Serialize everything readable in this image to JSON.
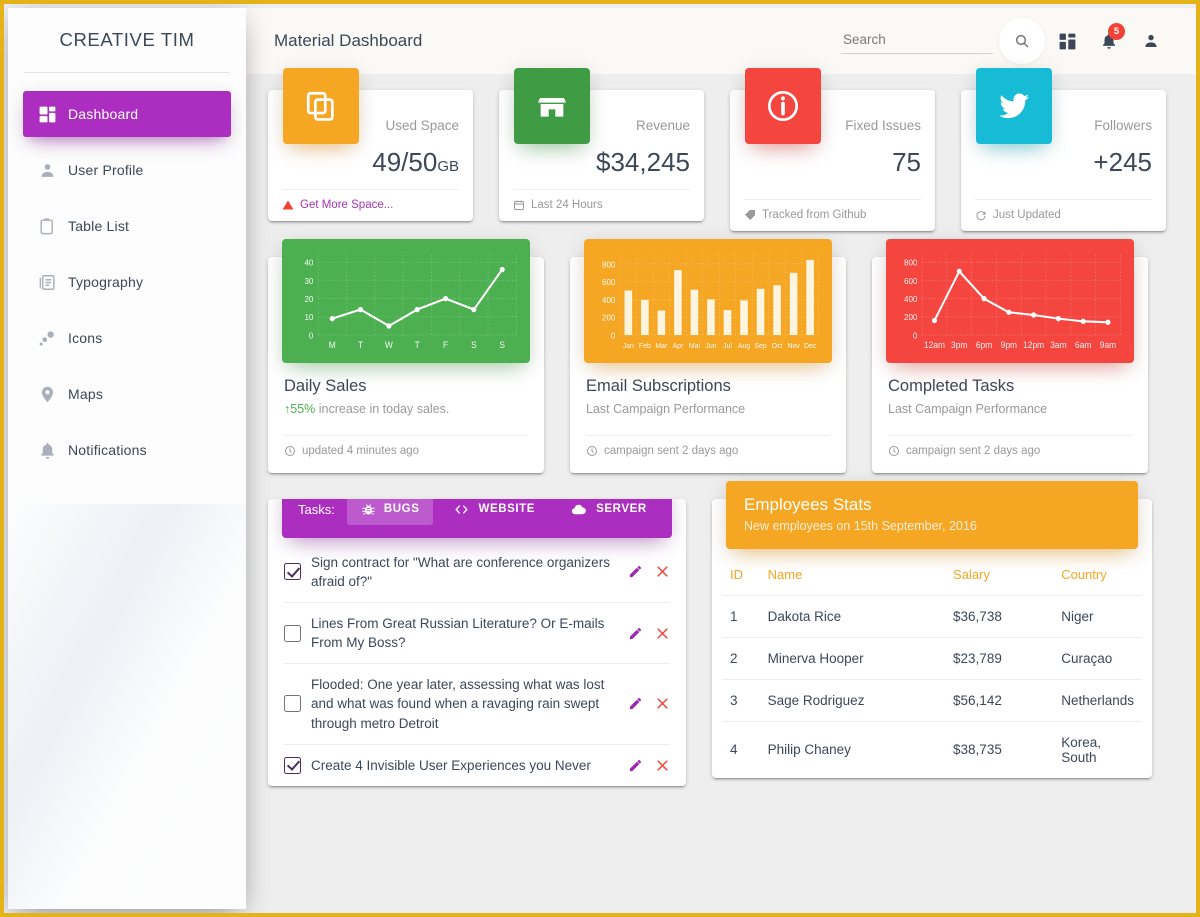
{
  "theme": {
    "purple": "#ab2ec0",
    "orange": "#f5a623",
    "green": "#4caf50",
    "red": "#f4453f",
    "blue": "#00bcd4",
    "page_border": "#e4b319"
  },
  "sidebar": {
    "brand": "CREATIVE TIM",
    "items": [
      {
        "label": "Dashboard",
        "icon": "dashboard-icon",
        "active": true
      },
      {
        "label": "User Profile",
        "icon": "person-icon",
        "active": false
      },
      {
        "label": "Table List",
        "icon": "clipboard-icon",
        "active": false
      },
      {
        "label": "Typography",
        "icon": "typography-icon",
        "active": false
      },
      {
        "label": "Icons",
        "icon": "bubbles-icon",
        "active": false
      },
      {
        "label": "Maps",
        "icon": "location-pin-icon",
        "active": false
      },
      {
        "label": "Notifications",
        "icon": "bell-icon",
        "active": false
      }
    ]
  },
  "topbar": {
    "title": "Material Dashboard",
    "search_placeholder": "Search",
    "search_value": "",
    "notification_count": "5"
  },
  "stats": [
    {
      "category": "Used Space",
      "value": "49/50",
      "unit": "GB",
      "icon": "copy-icon",
      "color": "#f5a623",
      "footer": "Get More Space...",
      "footer_icon": "warning-icon",
      "footer_style": "warn"
    },
    {
      "category": "Revenue",
      "value": "$34,245",
      "unit": "",
      "icon": "store-icon",
      "color": "#4caf50",
      "footer": "Last 24 Hours",
      "footer_icon": "calendar-icon",
      "footer_style": "normal"
    },
    {
      "category": "Fixed Issues",
      "value": "75",
      "unit": "",
      "icon": "info-icon",
      "color": "#f4453f",
      "footer": "Tracked from Github",
      "footer_icon": "tag-icon",
      "footer_style": "normal"
    },
    {
      "category": "Followers",
      "value": "+245",
      "unit": "",
      "icon": "twitter-icon",
      "color": "#00bcd4",
      "footer": "Just Updated",
      "footer_icon": "refresh-icon",
      "footer_style": "normal"
    }
  ],
  "chart_cards": [
    {
      "title": "Daily Sales",
      "subtitle_prefix": "55%",
      "subtitle_rest": " increase in today sales.",
      "footer": "updated 4 minutes ago",
      "footer_icon": "clock-icon"
    },
    {
      "title": "Email Subscriptions",
      "subtitle_prefix": "",
      "subtitle_rest": "Last Campaign Performance",
      "footer": "campaign sent 2 days ago",
      "footer_icon": "clock-icon"
    },
    {
      "title": "Completed Tasks",
      "subtitle_prefix": "",
      "subtitle_rest": "Last Campaign Performance",
      "footer": "campaign sent 2 days ago",
      "footer_icon": "clock-icon"
    }
  ],
  "chart_data": [
    {
      "type": "line",
      "title": "Daily Sales",
      "categories": [
        "M",
        "T",
        "W",
        "T",
        "F",
        "S",
        "S"
      ],
      "values": [
        9,
        14,
        5,
        14,
        20,
        14,
        36
      ],
      "yticks": [
        0,
        10,
        20,
        30,
        40
      ],
      "ylim": [
        0,
        44
      ],
      "xlabel": "",
      "ylabel": "",
      "grid": true,
      "legend": "none",
      "background": "#4caf50",
      "line_color": "#ffffff"
    },
    {
      "type": "bar",
      "title": "Email Subscriptions",
      "categories": [
        "Jan",
        "Feb",
        "Mar",
        "Apr",
        "Mai",
        "Jun",
        "Jul",
        "Aug",
        "Sep",
        "Oct",
        "Nov",
        "Dec"
      ],
      "values": [
        500,
        395,
        275,
        730,
        510,
        400,
        280,
        390,
        520,
        560,
        700,
        845
      ],
      "yticks": [
        0,
        200,
        400,
        600,
        800
      ],
      "ylim": [
        0,
        900
      ],
      "xlabel": "",
      "ylabel": "",
      "grid": true,
      "legend": "none",
      "background": "#f5a623",
      "bar_color": "#fdf5e0"
    },
    {
      "type": "line",
      "title": "Completed Tasks",
      "categories": [
        "12am",
        "3pm",
        "6pm",
        "9pm",
        "12pm",
        "3am",
        "6am",
        "9am"
      ],
      "values": [
        160,
        700,
        400,
        250,
        220,
        180,
        150,
        140
      ],
      "yticks": [
        0,
        200,
        400,
        600,
        800
      ],
      "ylim": [
        0,
        880
      ],
      "xlabel": "",
      "ylabel": "",
      "grid": true,
      "legend": "none",
      "background": "#f4453f",
      "line_color": "#ffffff"
    }
  ],
  "tasks": {
    "label": "Tasks:",
    "tabs": [
      {
        "label": "BUGS",
        "icon": "bug-icon",
        "active": true
      },
      {
        "label": "WEBSITE",
        "icon": "code-icon",
        "active": false
      },
      {
        "label": "SERVER",
        "icon": "cloud-icon",
        "active": false
      }
    ],
    "items": [
      {
        "checked": true,
        "text": "Sign contract for \"What are conference organizers afraid of?\""
      },
      {
        "checked": false,
        "text": "Lines From Great Russian Literature? Or E-mails From My Boss?"
      },
      {
        "checked": false,
        "text": "Flooded: One year later, assessing what was lost and what was found when a ravaging rain swept through metro Detroit"
      },
      {
        "checked": true,
        "text": "Create 4 Invisible User Experiences you Never"
      }
    ],
    "edit_icon": "pencil-icon",
    "delete_icon": "close-icon"
  },
  "employees": {
    "title": "Employees Stats",
    "subtitle": "New employees on 15th September, 2016",
    "columns": [
      "ID",
      "Name",
      "Salary",
      "Country"
    ],
    "rows": [
      [
        "1",
        "Dakota Rice",
        "$36,738",
        "Niger"
      ],
      [
        "2",
        "Minerva Hooper",
        "$23,789",
        "Curaçao"
      ],
      [
        "3",
        "Sage Rodriguez",
        "$56,142",
        "Netherlands"
      ],
      [
        "4",
        "Philip Chaney",
        "$38,735",
        "Korea, South"
      ]
    ]
  }
}
